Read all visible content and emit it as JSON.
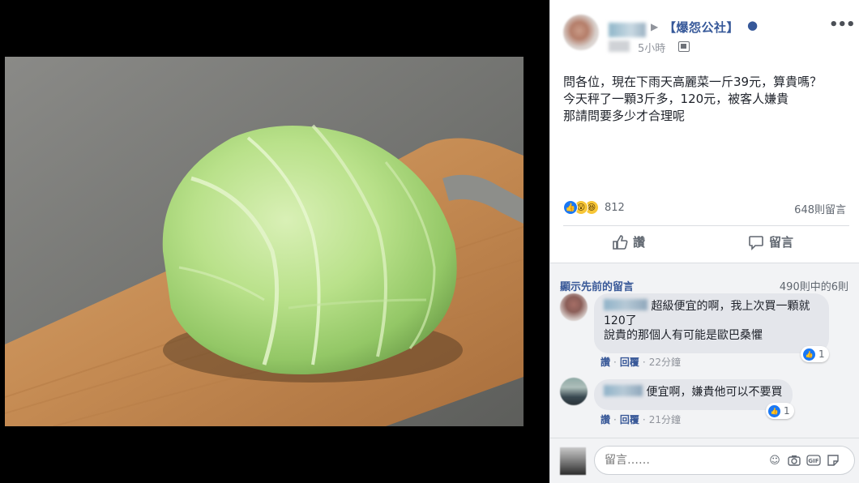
{
  "post": {
    "group_name": "【爆怨公社】",
    "time": "5小時",
    "text_lines": [
      "問各位，現在下雨天高麗菜一斤39元，算貴嗎？",
      "今天秤了一顆3斤多，120元，被客人嫌貴",
      "那請問要多少才合理呢"
    ],
    "reaction_count": "812",
    "comment_count": "648則留言",
    "like_label": "讚",
    "comment_label": "留言"
  },
  "comments_section": {
    "view_previous": "顯示先前的留言",
    "pager": "490則中的6則"
  },
  "comments": [
    {
      "line1": "超級便宜的啊，我上次買一顆就",
      "line2": "120了",
      "line3": "說貴的那個人有可能是歐巴桑懼",
      "likes": "1",
      "like_label": "讚",
      "reply_label": "回覆",
      "time": "22分鐘"
    },
    {
      "line1": "便宜啊，嫌貴他可以不要買",
      "likes": "1",
      "like_label": "讚",
      "reply_label": "回覆",
      "time": "21分鐘"
    }
  ],
  "composer": {
    "placeholder": "留言……"
  },
  "colors": {
    "link_blue": "#365899",
    "like_blue": "#1a78f4",
    "panel_bg": "#ffffff",
    "comments_bg": "#f2f3f5"
  }
}
